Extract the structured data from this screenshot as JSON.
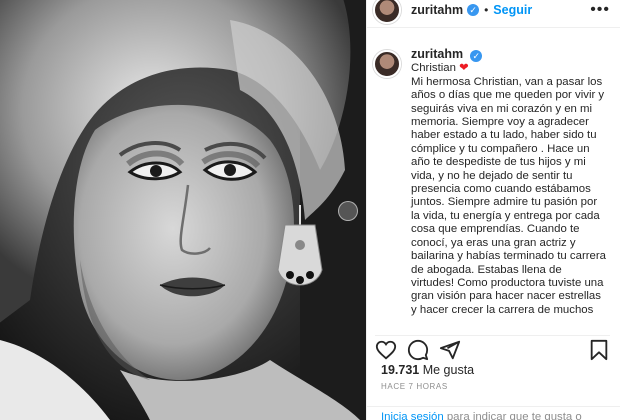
{
  "post": {
    "username": "zuritahm",
    "follow_label": "Seguir",
    "separator": "•",
    "more_label": "•••",
    "caption": {
      "first_line": "Christian",
      "heart": "❤",
      "body": "Mi hermosa Christian, van a pasar los años o días que me queden por vivir y seguirás viva en mi corazón y en mi memoria. Siempre voy a agradecer haber estado a tu lado, haber sido tu cómplice y tu compañero . Hace un año te despediste de tus hijos y mi vida, y no he dejado de sentir tu presencia como cuando estábamos juntos. Siempre admire tu pasión por la vida, tu energía y entrega por cada cosa que emprendías. Cuando te conocí, ya eras una gran actriz y bailarina y habías terminado tu carrera de abogada. Estabas llena de virtudes! Como productora tuviste una gran visión para hacer nacer estrellas y hacer crecer la carrera de muchos"
    },
    "likes_count": "19.731",
    "likes_suffix": " Me gusta",
    "timestamp": "HACE 7 HORAS",
    "login_link": "Inicia sesión",
    "login_text": " para indicar que te gusta o"
  },
  "icons": {
    "verified": "verified-badge",
    "like": "heart-outline",
    "comment": "speech-bubble",
    "share": "paper-plane",
    "save": "bookmark",
    "more": "more-dots"
  },
  "colors": {
    "accent": "#0095f6",
    "verified": "#3897f0",
    "heart": "#ed1c24",
    "muted": "#8e8e8e"
  }
}
